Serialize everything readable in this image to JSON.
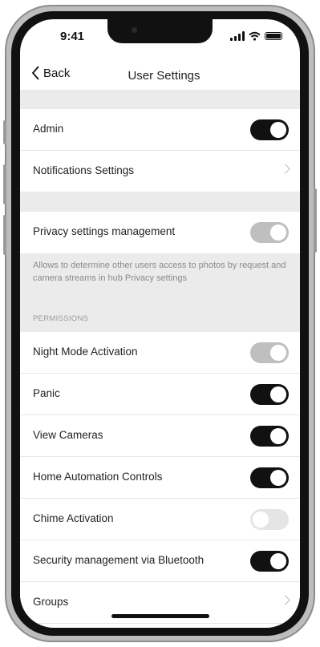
{
  "status_bar": {
    "time": "9:41"
  },
  "nav": {
    "back_label": "Back",
    "title": "User Settings"
  },
  "rows": {
    "admin": {
      "label": "Admin",
      "state": "on"
    },
    "notifications": {
      "label": "Notifications Settings"
    },
    "privacy": {
      "label": "Privacy settings management",
      "state": "on-disabled"
    },
    "privacy_description": "Allows to determine other users access to photos by request and camera streams in hub Privacy settings",
    "permissions_header": "PERMISSIONS",
    "night_mode": {
      "label": "Night  Mode Activation",
      "state": "on-disabled"
    },
    "panic": {
      "label": "Panic",
      "state": "on"
    },
    "view_cameras": {
      "label": "View Cameras",
      "state": "on"
    },
    "home_automation": {
      "label": "Home Automation Controls",
      "state": "on"
    },
    "chime": {
      "label": "Chime Activation",
      "state": "off"
    },
    "bluetooth": {
      "label": "Security management via Bluetooth",
      "state": "on"
    },
    "groups": {
      "label": "Groups"
    }
  },
  "colors": {
    "toggle_on": "#111111",
    "toggle_disabled": "#bfbfbf",
    "toggle_off": "#e5e5e5",
    "section_bg": "#ebebeb"
  }
}
